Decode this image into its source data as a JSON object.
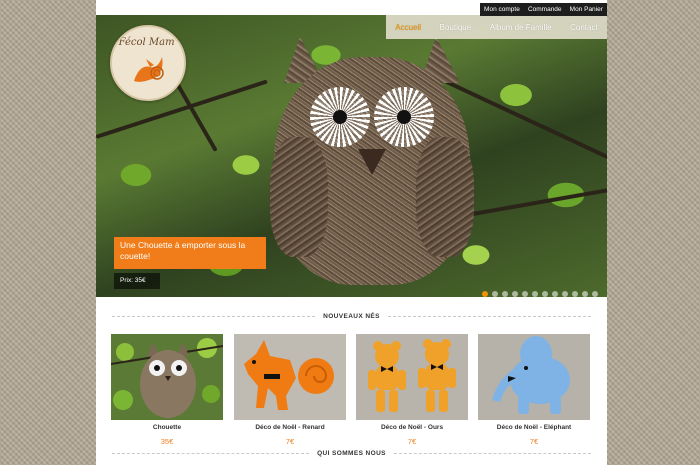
{
  "account": {
    "my_account": "Mon compte",
    "order": "Commande",
    "cart": "Mon Panier"
  },
  "logo": {
    "text": "Fécol Mam'"
  },
  "nav": {
    "home": "Accueil",
    "shop": "Boutique",
    "family_album": "Album de Famille",
    "contact": "Contact"
  },
  "slider": {
    "caption": "Une Chouette à emporter sous la couette!",
    "price": "Prix: 35€",
    "slide_count": 12,
    "active_slide": 1
  },
  "sections": {
    "new_arrivals": "NOUVEAUX NÉS",
    "about": "QUI SOMMES NOUS"
  },
  "products": [
    {
      "name": "Chouette",
      "price": "35€"
    },
    {
      "name": "Déco de Noël - Renard",
      "price": "7€"
    },
    {
      "name": "Déco de Noël - Ours",
      "price": "7€"
    },
    {
      "name": "Déco de Noël - Eléphant",
      "price": "7€"
    }
  ],
  "colors": {
    "accent": "#f39200",
    "caption_bg": "#f07d1a",
    "account_bar": "#1e1e1e"
  }
}
